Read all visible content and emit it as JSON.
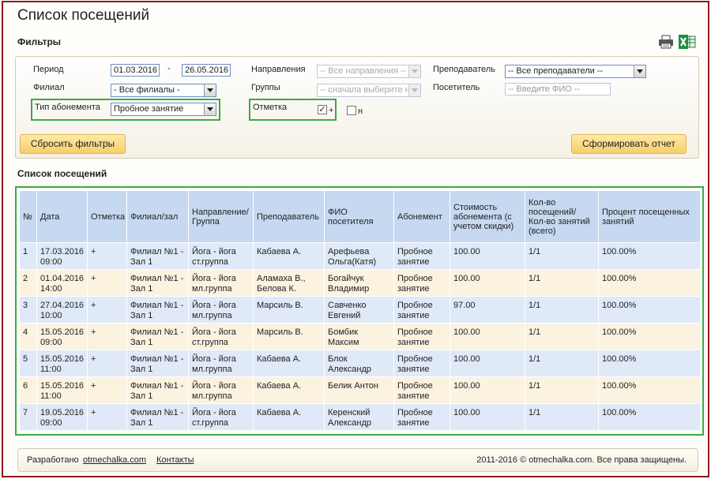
{
  "page_title": "Список посещений",
  "filters": {
    "title": "Фильтры",
    "period_label": "Период",
    "date_from": "01.03.2016",
    "date_sep": "-",
    "date_to": "26.05.2016",
    "branch_label": "Филиал",
    "branch_value": "- Все филиалы -",
    "subscription_type_label": "Тип абонемента",
    "subscription_type_value": "Пробное занятие",
    "directions_label": "Направления",
    "directions_value": "-- Все направления --",
    "groups_label": "Группы",
    "groups_value": "-- сначала выберите н",
    "mark_label": "Отметка",
    "mark_plus_label": "+",
    "mark_n_label": "н",
    "mark_plus_checked": true,
    "mark_n_checked": false,
    "teacher_label": "Преподаватель",
    "teacher_value": "-- Все преподаватели --",
    "visitor_label": "Посетитель",
    "visitor_placeholder": "-- Введите ФИО --",
    "reset_button": "Сбросить фильтры",
    "report_button": "Сформировать отчет"
  },
  "toolbar": {
    "print_icon": "printer-icon",
    "excel_icon": "excel-icon"
  },
  "list_title": "Список посещений",
  "table": {
    "headers": [
      "№",
      "Дата",
      "Отметка",
      "Филиал/зал",
      "Направление/ Группа",
      "Преподаватель",
      "ФИО посетителя",
      "Абонемент",
      "Стоимость абонемента (с учетом скидки)",
      "Кол-во посещений/ Кол-во занятий (всего)",
      "Процент посещенных занятий"
    ],
    "rows": [
      [
        "1",
        "17.03.2016 09:00",
        "+",
        "Филиал №1 - Зал 1",
        "Йога - йога ст.группа",
        "Кабаева А.",
        "Арефьева Ольга(Катя)",
        "Пробное занятие",
        "100.00",
        "1/1",
        "100.00%"
      ],
      [
        "2",
        "01.04.2016 14:00",
        "+",
        "Филиал №1 - Зал 1",
        "Йога - йога мл.группа",
        "Аламаха В., Белова К.",
        "Богайчук Владимир",
        "Пробное занятие",
        "100.00",
        "1/1",
        "100.00%"
      ],
      [
        "3",
        "27.04.2016 10:00",
        "+",
        "Филиал №1 - Зал 1",
        "Йога - йога мл.группа",
        "Марсиль В.",
        "Савченко Евгений",
        "Пробное занятие",
        "97.00",
        "1/1",
        "100.00%"
      ],
      [
        "4",
        "15.05.2016 09:00",
        "+",
        "Филиал №1 - Зал 1",
        "Йога - йога ст.группа",
        "Марсиль В.",
        "Бомбик Максим",
        "Пробное занятие",
        "100.00",
        "1/1",
        "100.00%"
      ],
      [
        "5",
        "15.05.2016 11:00",
        "+",
        "Филиал №1 - Зал 1",
        "Йога - йога мл.группа",
        "Кабаева А.",
        "Блок Александр",
        "Пробное занятие",
        "100.00",
        "1/1",
        "100.00%"
      ],
      [
        "6",
        "15.05.2016 11:00",
        "+",
        "Филиал №1 - Зал 1",
        "Йога - йога мл.группа",
        "Кабаева А.",
        "Белик Антон",
        "Пробное занятие",
        "100.00",
        "1/1",
        "100.00%"
      ],
      [
        "7",
        "19.05.2016 09:00",
        "+",
        "Филиал №1 - Зал 1",
        "Йога - йога ст.группа",
        "Кабаева А.",
        "Керенский Александр",
        "Пробное занятие",
        "100.00",
        "1/1",
        "100.00%"
      ]
    ]
  },
  "footer": {
    "developed_by": "Разработано",
    "developer_link": "otmechalka.com",
    "contacts_link": "Контакты",
    "copyright": "2011-2016 © otmechalka.com. Все права защищены."
  },
  "colors": {
    "highlight_green": "#3aaa45",
    "header_blue": "#c6d9f1",
    "row_blue": "#dfe9f7",
    "row_cream": "#fbf2e0",
    "button_yellow": "#f6cf6c",
    "frame_red": "#8b1a1a"
  }
}
